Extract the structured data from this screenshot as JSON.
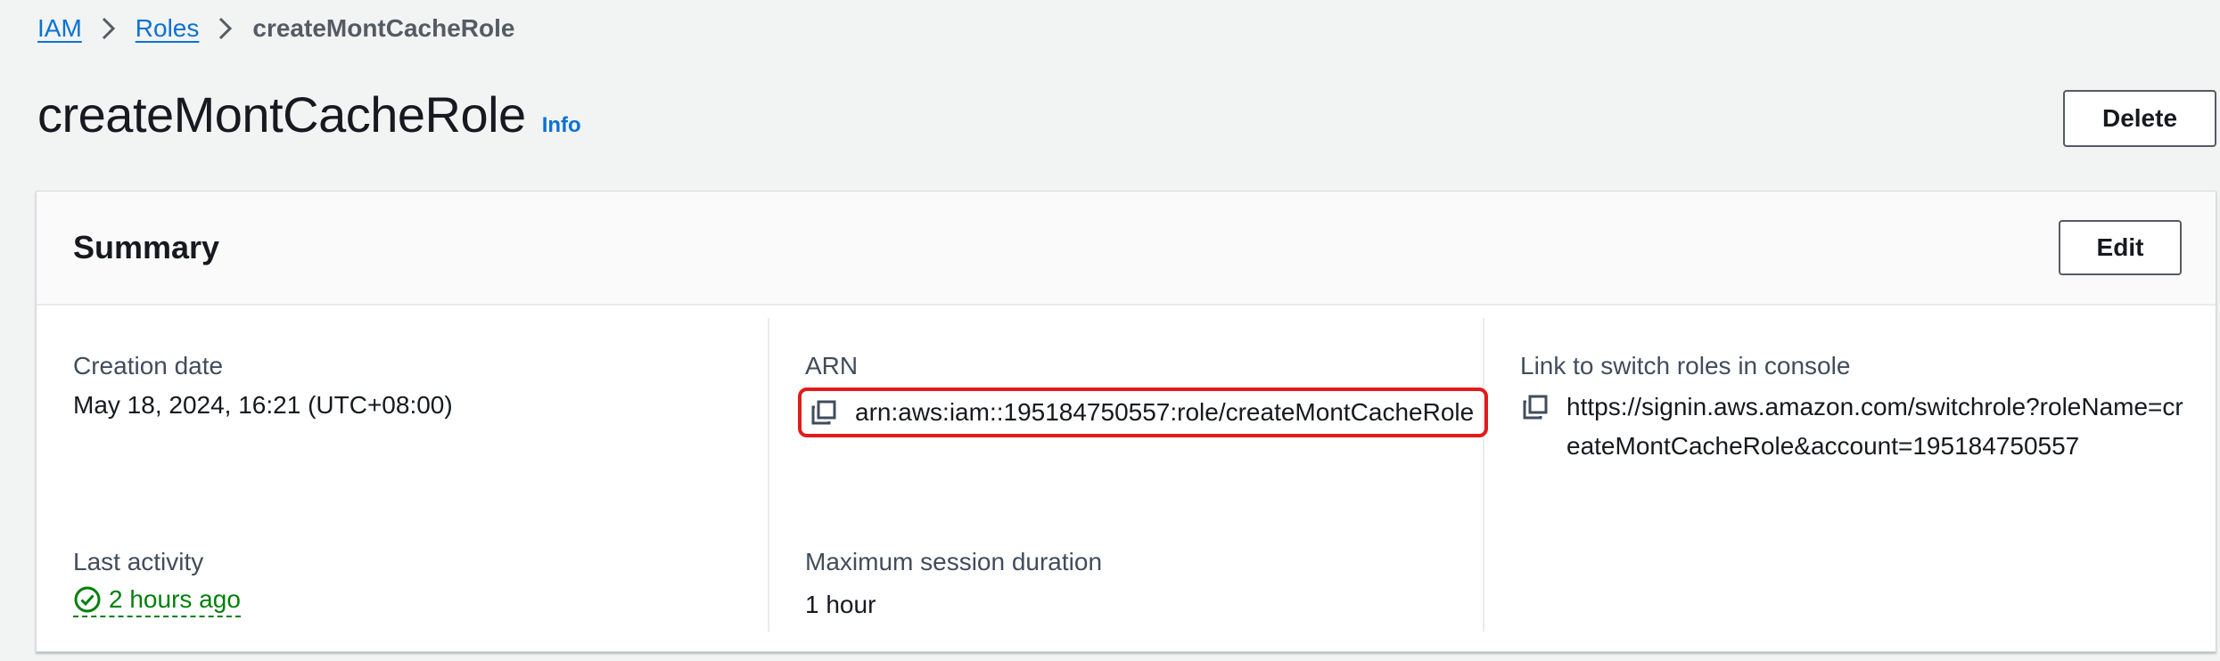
{
  "breadcrumb": {
    "items": [
      "IAM",
      "Roles"
    ],
    "current": "createMontCacheRole"
  },
  "page": {
    "title": "createMontCacheRole",
    "info_label": "Info",
    "delete_label": "Delete"
  },
  "summary": {
    "title": "Summary",
    "edit_label": "Edit",
    "creation_date": {
      "label": "Creation date",
      "value": "May 18, 2024, 16:21 (UTC+08:00)"
    },
    "last_activity": {
      "label": "Last activity",
      "value": "2 hours ago"
    },
    "arn": {
      "label": "ARN",
      "value": "arn:aws:iam::195184750557:role/createMontCacheRole"
    },
    "max_session": {
      "label": "Maximum session duration",
      "value": "1 hour"
    },
    "switch_link": {
      "label": "Link to switch roles in console",
      "value": "https://signin.aws.amazon.com/switchrole?roleName=createMontCacheRole&account=195184750557"
    }
  },
  "colors": {
    "link": "#0972d3",
    "success": "#037f0c",
    "highlight": "#e21b1b"
  }
}
